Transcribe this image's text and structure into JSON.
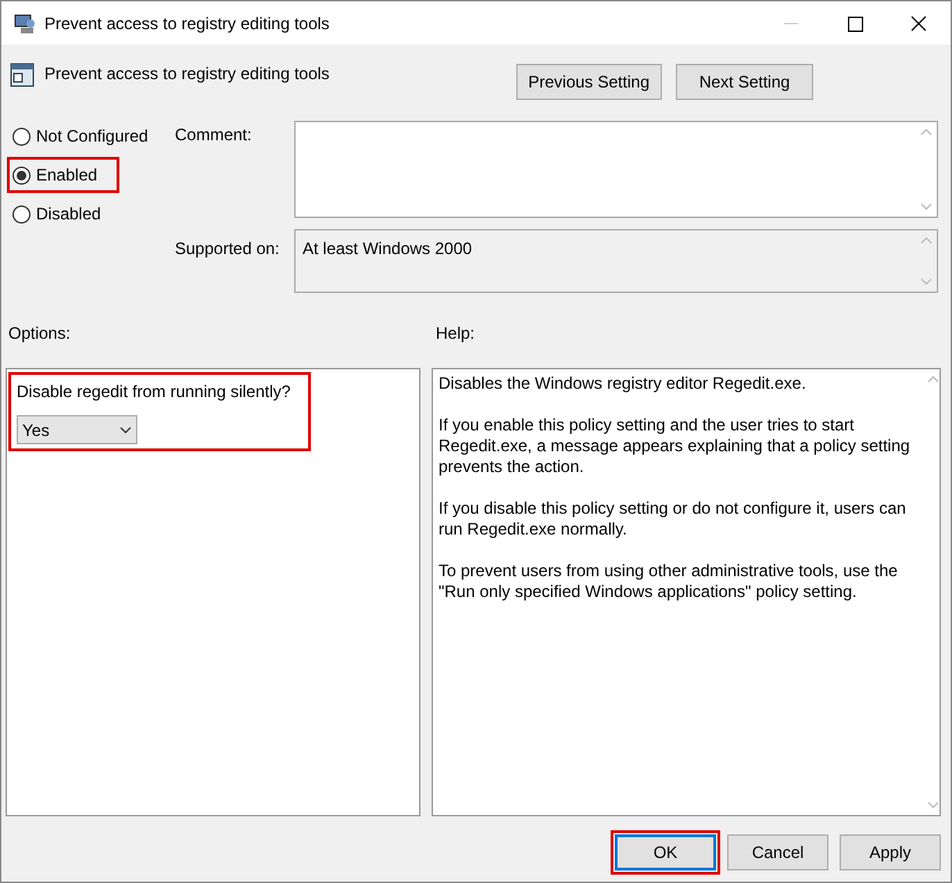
{
  "window": {
    "title": "Prevent access to registry editing tools"
  },
  "setting_title": "Prevent access to registry editing tools",
  "nav_buttons": [
    "Previous Setting",
    "Next Setting"
  ],
  "state_options": [
    {
      "label": "Not Configured",
      "selected": false,
      "highlighted": false
    },
    {
      "label": "Enabled",
      "selected": true,
      "highlighted": true
    },
    {
      "label": "Disabled",
      "selected": false,
      "highlighted": false
    }
  ],
  "comment": {
    "label": "Comment:"
  },
  "supported_on": {
    "label": "Supported on:",
    "value": "At least Windows 2000"
  },
  "options": {
    "label": "Options:",
    "question": "Disable regedit from running silently?",
    "value": "Yes",
    "highlighted": true
  },
  "help": {
    "label": "Help:",
    "paragraphs": [
      "Disables the Windows registry editor Regedit.exe.",
      "If you enable this policy setting and the user tries to start Regedit.exe, a message appears explaining that a policy setting prevents the action.",
      "If you disable this policy setting or do not configure it, users can run Regedit.exe normally.",
      "To prevent users from using other administrative tools, use the \"Run only specified Windows applications\" policy setting."
    ]
  },
  "buttons": [
    {
      "label": "OK",
      "default": true,
      "highlighted": true
    },
    {
      "label": "Cancel",
      "default": false,
      "highlighted": false
    },
    {
      "label": "Apply",
      "default": false,
      "highlighted": false
    }
  ]
}
